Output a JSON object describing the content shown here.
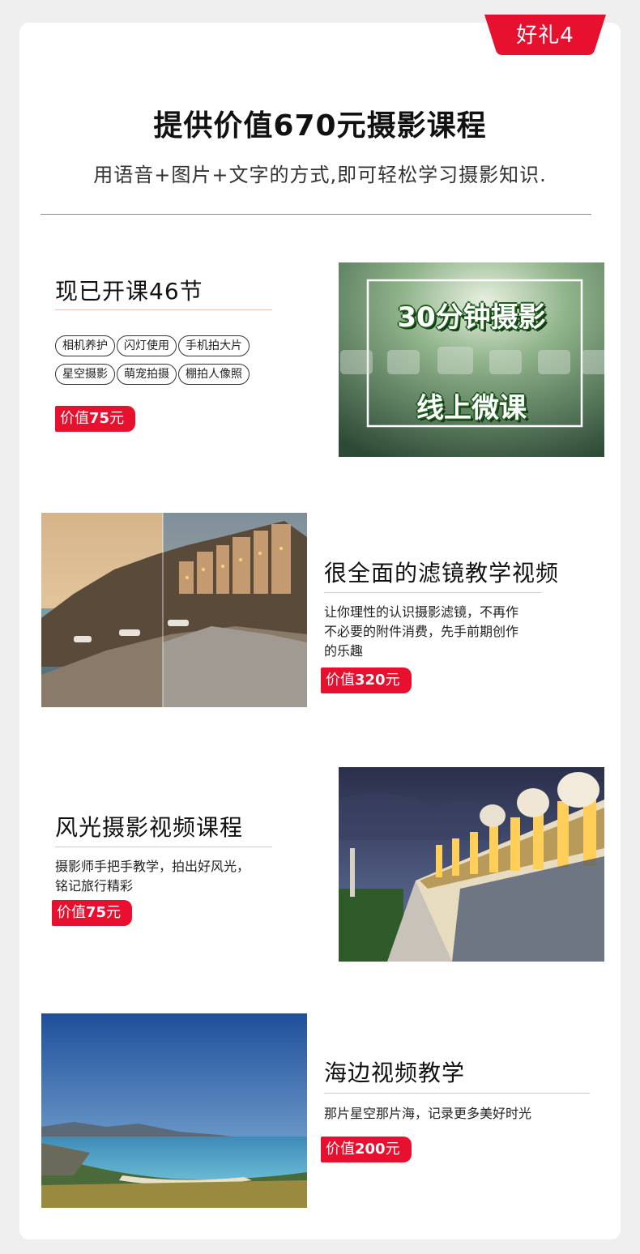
{
  "badge": {
    "label": "好礼4"
  },
  "header": {
    "title": "提供价值670元摄影课程",
    "subtitle": "用语音+图片+文字的方式,即可轻松学习摄影知识."
  },
  "colors": {
    "accent": "#e8102f",
    "divider": "#e8c3b8"
  },
  "sections": [
    {
      "title": "现已开课46节",
      "tags": [
        "相机养护",
        "闪灯使用",
        "手机拍大片",
        "星空摄影",
        "萌宠拍摄",
        "棚拍人像照"
      ],
      "price_prefix": "价值",
      "price_amount": "75",
      "price_unit": "元",
      "image": {
        "line1": "30分钟摄影",
        "line2": "线上微课"
      }
    },
    {
      "title": "很全面的滤镜教学视频",
      "desc_line1": "让你理性的认识摄影滤镜，不再作",
      "desc_line2": "不必要的附件消费，先手前期创作",
      "desc_line3": "的乐趣",
      "price_prefix": "价值",
      "price_amount": "320",
      "price_unit": "元"
    },
    {
      "title": "风光摄影视频课程",
      "desc_line1": "摄影师手把手教学，拍出好风光，",
      "desc_line2": "铭记旅行精彩",
      "price_prefix": "价值",
      "price_amount": "75",
      "price_unit": "元"
    },
    {
      "title": "海边视频教学",
      "desc_line1": "那片星空那片海，记录更多美好时光",
      "price_prefix": "价值",
      "price_amount": "200",
      "price_unit": "元"
    }
  ]
}
